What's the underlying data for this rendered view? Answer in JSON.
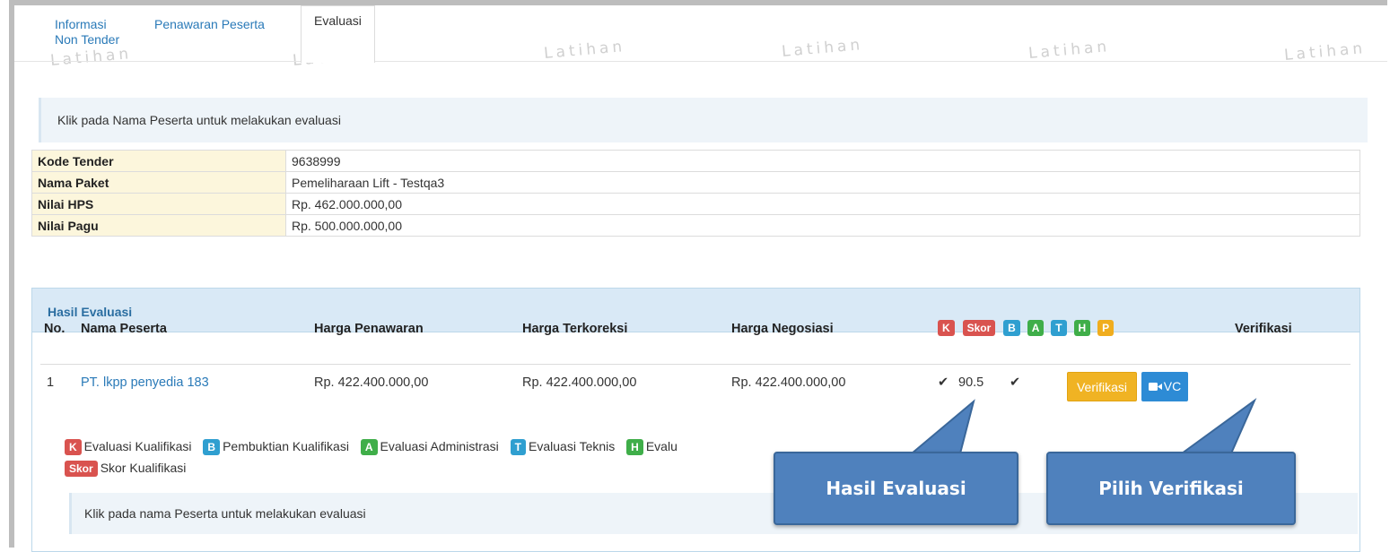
{
  "tabs": [
    {
      "label": "Informasi\nNon Tender"
    },
    {
      "label": "Penawaran Peserta"
    },
    {
      "label": "Evaluasi"
    }
  ],
  "watermark_text": "Latihan",
  "info_top": "Klik pada Nama Peserta untuk melakukan evaluasi",
  "detail": [
    {
      "label": "Kode Tender",
      "value": "9638999"
    },
    {
      "label": "Nama Paket",
      "value": "Pemeliharaan Lift - Testqa3"
    },
    {
      "label": "Nilai HPS",
      "value": "Rp. 462.000.000,00"
    },
    {
      "label": "Nilai Pagu",
      "value": "Rp. 500.000.000,00"
    }
  ],
  "panel_title": "Hasil Evaluasi",
  "columns": {
    "no": "No.",
    "nama": "Nama Peserta",
    "harga_penawaran": "Harga Penawaran",
    "harga_terkoreksi": "Harga Terkoreksi",
    "harga_negosiasi": "Harga Negosiasi",
    "verifikasi": "Verifikasi"
  },
  "eval_badges": [
    {
      "text": "K",
      "color": "#d9534f"
    },
    {
      "text": "Skor",
      "color": "#d9534f"
    },
    {
      "text": "B",
      "color": "#2f9fd0"
    },
    {
      "text": "A",
      "color": "#3fae49"
    },
    {
      "text": "T",
      "color": "#2f9fd0"
    },
    {
      "text": "H",
      "color": "#3fae49"
    },
    {
      "text": "P",
      "color": "#f0ad1e"
    }
  ],
  "rows": [
    {
      "no": "1",
      "nama": "PT. lkpp penyedia 183",
      "harga_penawaran": "Rp. 422.400.000,00",
      "harga_terkoreksi": "Rp. 422.400.000,00",
      "harga_negosiasi": "Rp. 422.400.000,00",
      "k_check": "✔",
      "skor": "90.5",
      "b_check": "✔",
      "btn_verifikasi": "Verifikasi",
      "btn_vc": "VC"
    }
  ],
  "legend": [
    {
      "badge": "K",
      "text": "Evaluasi Kualifikasi"
    },
    {
      "badge": "B",
      "text": "Pembuktian Kualifikasi"
    },
    {
      "badge": "A",
      "text": "Evaluasi Administrasi"
    },
    {
      "badge": "T",
      "text": "Evaluasi Teknis"
    },
    {
      "badge": "H",
      "text": "Evalu"
    },
    {
      "badge": "Skor",
      "text": "Skor Kualifikasi"
    }
  ],
  "info_bottom": "Klik pada nama Peserta untuk melakukan evaluasi",
  "callouts": {
    "hasil": "Hasil Evaluasi",
    "pilih": "Pilih Verifikasi"
  }
}
